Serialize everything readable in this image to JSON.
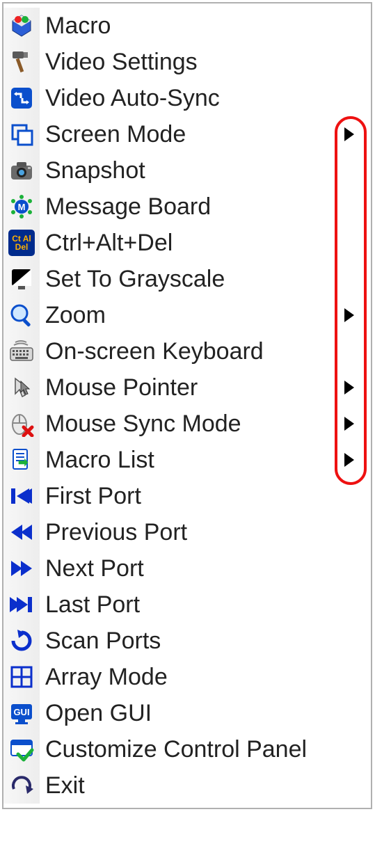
{
  "menu": {
    "items": [
      {
        "id": "macro",
        "label": "Macro",
        "submenu": false
      },
      {
        "id": "video-settings",
        "label": "Video Settings",
        "submenu": false
      },
      {
        "id": "video-auto-sync",
        "label": "Video Auto-Sync",
        "submenu": false
      },
      {
        "id": "screen-mode",
        "label": "Screen Mode",
        "submenu": true
      },
      {
        "id": "snapshot",
        "label": "Snapshot",
        "submenu": false
      },
      {
        "id": "message-board",
        "label": "Message Board",
        "submenu": false
      },
      {
        "id": "ctrl-alt-del",
        "label": "Ctrl+Alt+Del",
        "submenu": false
      },
      {
        "id": "set-to-grayscale",
        "label": "Set To Grayscale",
        "submenu": false
      },
      {
        "id": "zoom",
        "label": "Zoom",
        "submenu": true
      },
      {
        "id": "on-screen-keyboard",
        "label": "On-screen Keyboard",
        "submenu": false
      },
      {
        "id": "mouse-pointer",
        "label": "Mouse Pointer",
        "submenu": true
      },
      {
        "id": "mouse-sync-mode",
        "label": "Mouse Sync Mode",
        "submenu": true
      },
      {
        "id": "macro-list",
        "label": "Macro List",
        "submenu": true
      },
      {
        "id": "first-port",
        "label": "First Port",
        "submenu": false
      },
      {
        "id": "previous-port",
        "label": "Previous Port",
        "submenu": false
      },
      {
        "id": "next-port",
        "label": "Next Port",
        "submenu": false
      },
      {
        "id": "last-port",
        "label": "Last Port",
        "submenu": false
      },
      {
        "id": "scan-ports",
        "label": "Scan Ports",
        "submenu": false
      },
      {
        "id": "array-mode",
        "label": "Array Mode",
        "submenu": false
      },
      {
        "id": "open-gui",
        "label": "Open GUI",
        "submenu": false
      },
      {
        "id": "customize-panel",
        "label": "Customize Control Panel",
        "submenu": false
      },
      {
        "id": "exit",
        "label": "Exit",
        "submenu": false
      }
    ]
  },
  "annotation": {
    "highlighted_submenu_arrows": [
      "screen-mode",
      "zoom",
      "mouse-pointer",
      "mouse-sync-mode",
      "macro-list"
    ]
  }
}
